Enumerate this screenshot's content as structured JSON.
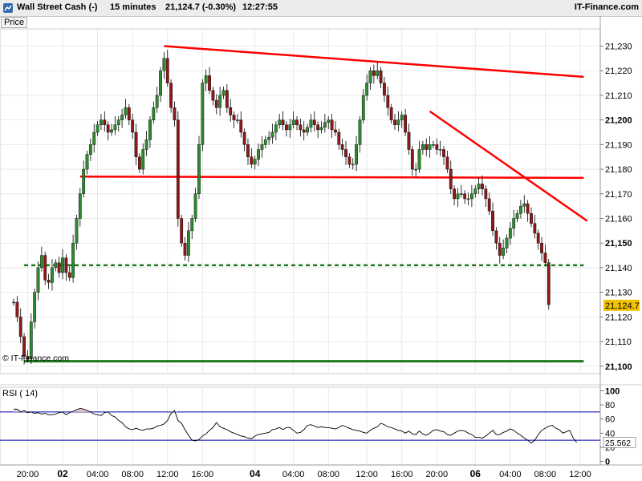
{
  "header": {
    "instrument": "Wall Street Cash (-)",
    "timeframe": "15 minutes",
    "quote": "21,124.7 (-0.30%)",
    "time": "12:27:55",
    "brand": "IT-Finance.com"
  },
  "price_tag": "Price",
  "copyright": "© IT-Finance.com",
  "rsi_label": "RSI ( 14)",
  "rsi_value_label": "25.562",
  "last_price_label": "21,124.7",
  "colors": {
    "up": "#2e8b2e",
    "down": "#8b1a1a",
    "wick": "#000000",
    "trendline": "#ff0000",
    "support_dashed": "#1a7a1a",
    "support_solid": "#1a7a1a",
    "rsi_line": "#000000",
    "rsi_band": "#0000aa",
    "rsi_fill": "#e8c8c8",
    "last_price_bg": "#f2c200"
  },
  "chart_data": [
    {
      "type": "candlestick",
      "title": "Wall Street Cash (-) 15 minutes",
      "ylabel": "Price",
      "ylim": [
        21097,
        21237
      ],
      "yticks": [
        21100,
        21110,
        21120,
        21130,
        21140,
        21150,
        21160,
        21170,
        21180,
        21190,
        21200,
        21210,
        21220,
        21230
      ],
      "ytick_labels": [
        "21,100",
        "21,110",
        "21,120",
        "21,130",
        "21,140",
        "21,150",
        "21,160",
        "21,170",
        "21,180",
        "21,190",
        "21,200",
        "21,210",
        "21,220",
        "21,230"
      ],
      "ytick_bold": [
        21100,
        21150,
        21200
      ],
      "xlim": [
        0,
        162
      ],
      "xticks": [
        {
          "x": 4,
          "label": "20:00",
          "bold": false
        },
        {
          "x": 14,
          "label": "02",
          "bold": true
        },
        {
          "x": 24,
          "label": "04:00",
          "bold": false
        },
        {
          "x": 34,
          "label": "08:00",
          "bold": false
        },
        {
          "x": 44,
          "label": "12:00",
          "bold": false
        },
        {
          "x": 54,
          "label": "16:00",
          "bold": false
        },
        {
          "x": 69,
          "label": "04",
          "bold": true
        },
        {
          "x": 80,
          "label": "04:00",
          "bold": false
        },
        {
          "x": 90,
          "label": "08:00",
          "bold": false
        },
        {
          "x": 101,
          "label": "12:00",
          "bold": false
        },
        {
          "x": 111,
          "label": "16:00",
          "bold": false
        },
        {
          "x": 121,
          "label": "20:00",
          "bold": false
        },
        {
          "x": 132,
          "label": "06",
          "bold": true
        },
        {
          "x": 142,
          "label": "04:00",
          "bold": false
        },
        {
          "x": 152,
          "label": "08:00",
          "bold": false
        },
        {
          "x": 162,
          "label": "12:00",
          "bold": false
        }
      ],
      "last_price": 21124.7,
      "closes": [
        21126,
        21120,
        21112,
        21104,
        21103,
        21118,
        21130,
        21140,
        21145,
        21135,
        21134,
        21140,
        21142,
        21138,
        21144,
        21138,
        21136,
        21150,
        21160,
        21170,
        21180,
        21186,
        21190,
        21195,
        21198,
        21200,
        21198,
        21195,
        21196,
        21198,
        21200,
        21202,
        21205,
        21200,
        21195,
        21185,
        21180,
        21188,
        21192,
        21200,
        21205,
        21210,
        21220,
        21225,
        21215,
        21205,
        21200,
        21160,
        21150,
        21145,
        21155,
        21160,
        21170,
        21190,
        21215,
        21218,
        21212,
        21208,
        21205,
        21210,
        21212,
        21205,
        21202,
        21200,
        21200,
        21195,
        21190,
        21185,
        21182,
        21184,
        21188,
        21190,
        21192,
        21193,
        21195,
        21198,
        21200,
        21198,
        21196,
        21198,
        21200,
        21198,
        21196,
        21195,
        21197,
        21200,
        21198,
        21196,
        21197,
        21199,
        21200,
        21196,
        21195,
        21190,
        21188,
        21185,
        21182,
        21182,
        21190,
        21200,
        21210,
        21215,
        21220,
        21218,
        21220,
        21215,
        21210,
        21205,
        21200,
        21198,
        21200,
        21202,
        21195,
        21188,
        21180,
        21180,
        21188,
        21190,
        21188,
        21190,
        21190,
        21188,
        21188,
        21185,
        21180,
        21172,
        21168,
        21170,
        21170,
        21168,
        21168,
        21170,
        21172,
        21174,
        21172,
        21168,
        21163,
        21155,
        21150,
        21145,
        21148,
        21152,
        21156,
        21160,
        21162,
        21165,
        21166,
        21162,
        21158,
        21154,
        21150,
        21146,
        21142,
        21125
      ],
      "lines": [
        {
          "kind": "trend",
          "from": [
            43,
            21230
          ],
          "to": [
            163,
            21217.5
          ]
        },
        {
          "kind": "trend",
          "from": [
            119,
            21203.5
          ],
          "to": [
            164,
            21159
          ]
        },
        {
          "kind": "resistance",
          "from": [
            19,
            21177
          ],
          "to": [
            163,
            21176.5
          ]
        },
        {
          "kind": "support_dashed",
          "from": [
            3,
            21141
          ],
          "to": [
            163,
            21141
          ]
        },
        {
          "kind": "support_solid",
          "from": [
            3,
            21102
          ],
          "to": [
            163,
            21102
          ]
        }
      ]
    },
    {
      "type": "line",
      "title": "RSI ( 14)",
      "ylim": [
        -5,
        105
      ],
      "yticks": [
        0,
        20,
        40,
        60,
        80,
        100
      ],
      "ytick_labels": [
        "0",
        "20",
        "40",
        "60",
        "80",
        "100"
      ],
      "ytick_bold": [
        0,
        100
      ],
      "bands": [
        70,
        30
      ],
      "xlim": [
        0,
        162
      ],
      "values": [
        74,
        74,
        70,
        72,
        69,
        70,
        68,
        69,
        67,
        68,
        66,
        66,
        67,
        69,
        70,
        66,
        69,
        71,
        73,
        75,
        74,
        72,
        70,
        67,
        66,
        65,
        69,
        70,
        65,
        63,
        58,
        55,
        49,
        46,
        45,
        47,
        45,
        44,
        46,
        46,
        47,
        50,
        51,
        53,
        58,
        68,
        72,
        58,
        54,
        45,
        37,
        30,
        29,
        31,
        36,
        39,
        44,
        48,
        55,
        49,
        47,
        45,
        42,
        40,
        38,
        36,
        35,
        33,
        32,
        36,
        38,
        39,
        40,
        41,
        45,
        46,
        48,
        45,
        48,
        48,
        44,
        40,
        41,
        45,
        51,
        52,
        50,
        48,
        49,
        48,
        48,
        47,
        46,
        48,
        51,
        49,
        47,
        45,
        44,
        43,
        41,
        40,
        44,
        47,
        49,
        54,
        52,
        49,
        48,
        46,
        44,
        43,
        40,
        43,
        39,
        38,
        43,
        39,
        37,
        40,
        44,
        45,
        43,
        42,
        38,
        37,
        40,
        43,
        44,
        43,
        40,
        38,
        34,
        34,
        33,
        36,
        40,
        44,
        38,
        38,
        41,
        43,
        46,
        44,
        40,
        37,
        33,
        30,
        26,
        30,
        38,
        44,
        47,
        50,
        51,
        47,
        45,
        40,
        42,
        44,
        33,
        27
      ]
    }
  ]
}
